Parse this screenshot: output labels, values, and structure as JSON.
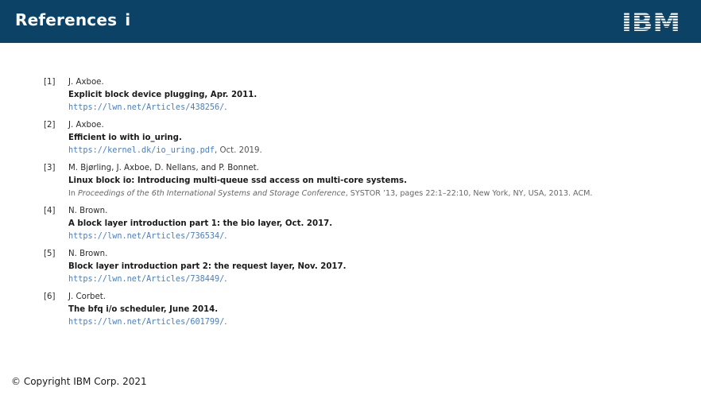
{
  "header": {
    "title": "References",
    "title_suffix": "i",
    "logo_text": "IBM",
    "background_color": "#0c4266"
  },
  "references": [
    {
      "num": "[1]",
      "authors": "J. Axboe.",
      "title": "Explicit block device plugging, Apr. 2011.",
      "url": "https://lwn.net/Articles/438256/",
      "tail": "."
    },
    {
      "num": "[2]",
      "authors": "J. Axboe.",
      "title": "Efficient io with io_uring.",
      "url": "https://kernel.dk/io_uring.pdf",
      "tail": ", Oct. 2019."
    },
    {
      "num": "[3]",
      "authors": "M. Bjørling, J. Axboe, D. Nellans, and P. Bonnet.",
      "title": "Linux block io: Introducing multi-queue ssd access on multi-core systems.",
      "pub_prefix": "In ",
      "pub_italic": "Proceedings of the 6th International Systems and Storage Conference",
      "pub_rest": ", SYSTOR ’13, pages 22:1–22:10, New York, NY, USA, 2013. ACM."
    },
    {
      "num": "[4]",
      "authors": "N. Brown.",
      "title": "A block layer introduction part 1: the bio layer, Oct. 2017.",
      "url": "https://lwn.net/Articles/736534/",
      "tail": "."
    },
    {
      "num": "[5]",
      "authors": "N. Brown.",
      "title": "Block layer introduction part 2: the request layer, Nov. 2017.",
      "url": "https://lwn.net/Articles/738449/",
      "tail": "."
    },
    {
      "num": "[6]",
      "authors": "J. Corbet.",
      "title": "The bfq i/o scheduler, June 2014.",
      "url": "https://lwn.net/Articles/601799/",
      "tail": "."
    }
  ],
  "footer": {
    "copyright": "© Copyright IBM Corp. 2021"
  },
  "colors": {
    "link": "#4a7fbf",
    "text": "#2b2b2b"
  }
}
